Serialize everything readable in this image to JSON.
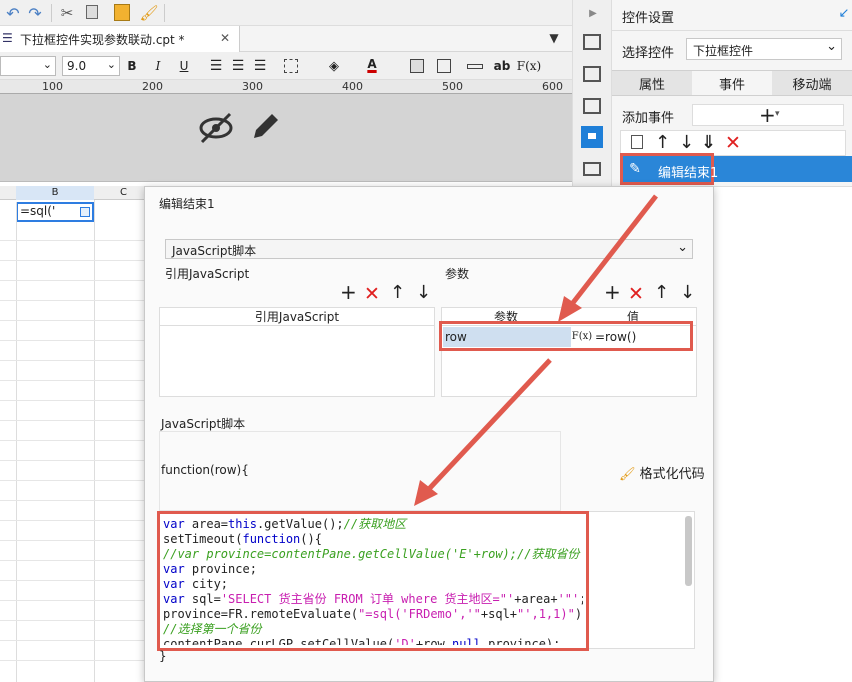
{
  "toolbar": {
    "icons": [
      "undo-icon",
      "redo-icon",
      "cut-icon",
      "copy-icon",
      "paste-icon",
      "format-painter-icon"
    ]
  },
  "tab": {
    "label": "下拉框控件实现参数联动.cpt *",
    "close": "✕",
    "icon": "☰"
  },
  "format": {
    "font_size": "9.0",
    "bold": "B",
    "italic": "I",
    "underline": "U",
    "ab": "ab",
    "fx": "F(x)"
  },
  "ruler": {
    "ticks": [
      "100",
      "200",
      "300",
      "400",
      "500",
      "600"
    ]
  },
  "sheet": {
    "col_b": "B",
    "col_c": "C",
    "cell_value": "=sql('"
  },
  "panel": {
    "title": "控件设置",
    "select_label": "选择控件",
    "select_value": "下拉框控件",
    "tabs": [
      "属性",
      "事件",
      "移动端"
    ],
    "add_event_label": "添加事件",
    "add_event_btn": "+",
    "event_item": "编辑结束1"
  },
  "dialog": {
    "title": "编辑结束1",
    "script_type": "JavaScript脚本",
    "ref_js_label": "引用JavaScript",
    "ref_js_header": "引用JavaScript",
    "params_label": "参数",
    "params_col1": "参数",
    "params_col2": "值",
    "param_name": "row",
    "param_value": "=row()",
    "fx": "F(x)",
    "script_label": "JavaScript脚本",
    "func_header": "function(row){",
    "format_code": "格式化代码",
    "closing": "}",
    "code_lines": [
      "var area=this.getValue();//获取地区",
      "setTimeout(function(){",
      "//var province=contentPane.getCellValue('E'+row);//获取省份",
      "var province;",
      "var city;",
      "var sql='SELECT 货主省份 FROM 订单 where 货主地区=\"'+area+'\"';",
      "province=FR.remoteEvaluate(\"=sql('FRDemo','\"+sql+\"',1,1)\");",
      "//选择第一个省份",
      "contentPane.curLGP.setCellValue('D'+row,null,province);"
    ]
  }
}
